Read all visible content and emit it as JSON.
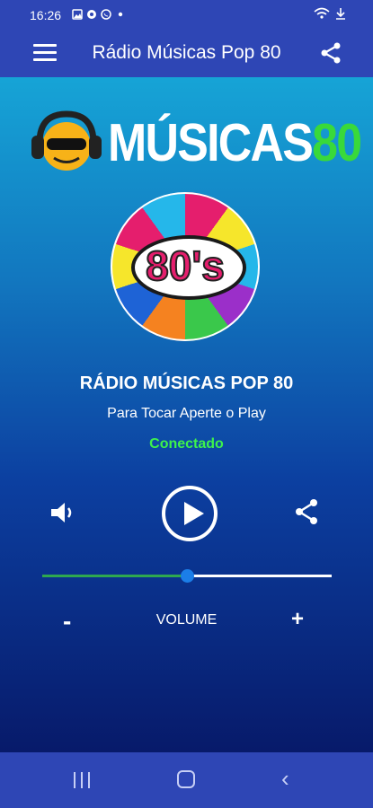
{
  "status_bar": {
    "time": "16:26",
    "icons": [
      "gallery-icon",
      "steam-icon",
      "whatsapp-icon",
      "dot-icon"
    ],
    "right_icons": [
      "wifi-icon",
      "download-icon"
    ]
  },
  "app_bar": {
    "title": "Rádio Músicas Pop 80",
    "menu_icon": "hamburger-menu-icon",
    "share_icon": "share-icon"
  },
  "logo": {
    "text_main": "MÚSICAS",
    "text_accent": "80",
    "accent_color": "#39d93a"
  },
  "disc": {
    "label": "80's"
  },
  "player": {
    "station_name": "RÁDIO MÚSICAS POP 80",
    "instruction": "Para Tocar Aperte o Play",
    "status": "Conectado",
    "status_color": "#3df24c",
    "volume_level": 0.5
  },
  "volume": {
    "minus": "-",
    "label": "VOLUME",
    "plus": "+"
  },
  "nav_bar": {
    "recent_icon": "recent-apps-icon",
    "home_icon": "home-icon",
    "back_icon": "back-icon"
  },
  "colors": {
    "app_bar": "#2e46b5",
    "slider_fill": "#2ea84f",
    "slider_thumb": "#1b7ee8"
  }
}
